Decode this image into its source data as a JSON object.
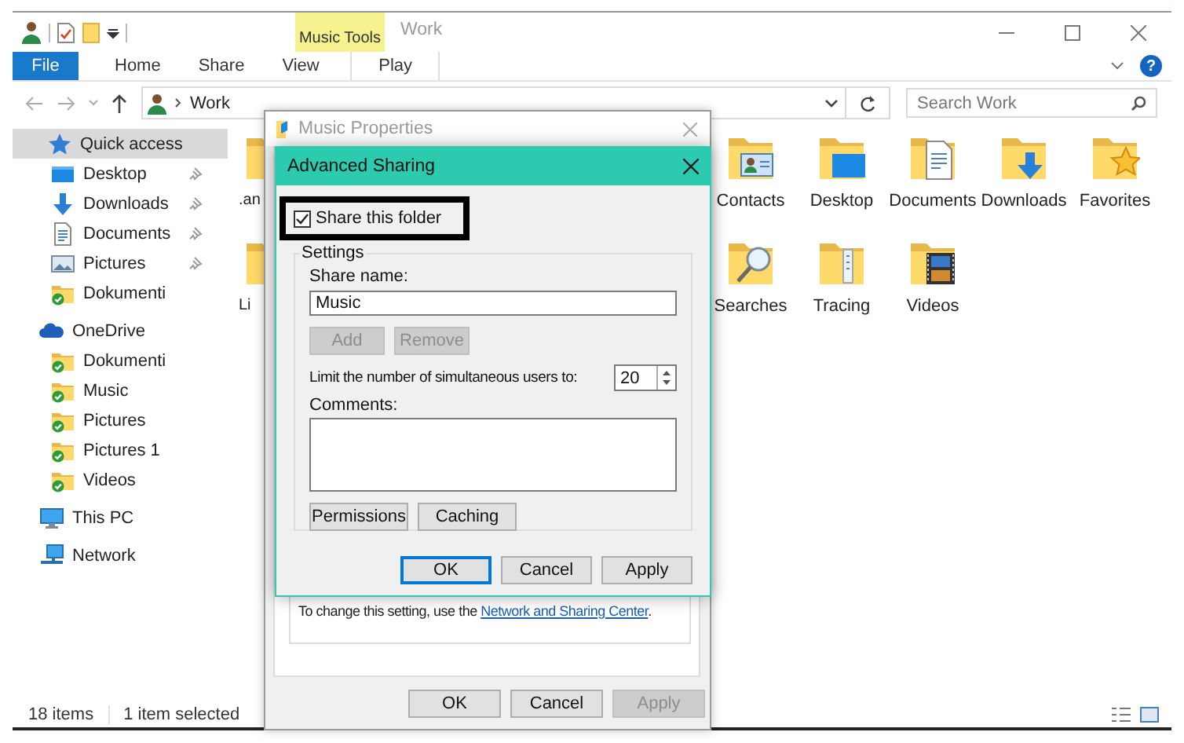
{
  "title_bar": {
    "contextual_group": "Music Tools",
    "title": "Work"
  },
  "ribbon": {
    "tabs": [
      {
        "label": "File",
        "kind": "file",
        "selected": false
      },
      {
        "label": "Home",
        "kind": "tab",
        "selected": false
      },
      {
        "label": "Share",
        "kind": "tab",
        "selected": false
      },
      {
        "label": "View",
        "kind": "tab",
        "selected": false
      },
      {
        "label": "Play",
        "kind": "contextual",
        "selected": false
      }
    ],
    "help": "?"
  },
  "address_bar": {
    "path": "Work"
  },
  "search": {
    "placeholder": "Search Work"
  },
  "sidebar": {
    "items": [
      {
        "label": "Quick access",
        "kind": "star",
        "selected": true,
        "children": [
          {
            "label": "Desktop",
            "kind": "desktop",
            "pinned": true,
            "selected": false
          },
          {
            "label": "Downloads",
            "kind": "downloads",
            "pinned": true,
            "selected": false
          },
          {
            "label": "Documents",
            "kind": "documents",
            "pinned": true,
            "selected": false
          },
          {
            "label": "Pictures",
            "kind": "pictures",
            "pinned": true,
            "selected": false
          },
          {
            "label": "Dokumenti",
            "kind": "synced",
            "pinned": false,
            "selected": false
          }
        ]
      },
      {
        "label": "OneDrive",
        "kind": "cloud",
        "selected": false,
        "children": [
          {
            "label": "Dokumenti",
            "kind": "synced",
            "pinned": false,
            "selected": false
          },
          {
            "label": "Music",
            "kind": "synced",
            "pinned": false,
            "selected": false
          },
          {
            "label": "Pictures",
            "kind": "synced",
            "pinned": false,
            "selected": false
          },
          {
            "label": "Pictures 1",
            "kind": "synced",
            "pinned": false,
            "selected": false
          },
          {
            "label": "Videos",
            "kind": "synced",
            "pinned": false,
            "selected": false
          }
        ]
      },
      {
        "label": "This PC",
        "kind": "pc",
        "selected": false
      },
      {
        "label": "Network",
        "kind": "network",
        "selected": false
      }
    ]
  },
  "content": {
    "items": [
      {
        "label": ".an",
        "kind": "folder"
      },
      {
        "label": "Contacts",
        "kind": "contacts"
      },
      {
        "label": "Desktop",
        "kind": "desktop"
      },
      {
        "label": "Documents",
        "kind": "documents"
      },
      {
        "label": "Downloads",
        "kind": "downloads"
      },
      {
        "label": "Favorites",
        "kind": "favorites"
      },
      {
        "label": "Li",
        "kind": "folder"
      },
      {
        "label": "Searches",
        "kind": "searches"
      },
      {
        "label": "Tracing",
        "kind": "tracing"
      },
      {
        "label": "Videos",
        "kind": "videos"
      }
    ]
  },
  "status_bar": {
    "item_count": "18 items",
    "selection": "1 item selected"
  },
  "music_properties": {
    "title": "Music Properties",
    "note": "To change this setting, use the",
    "link": "Network and Sharing Center",
    "note_end": ".",
    "buttons": [
      {
        "label": "OK",
        "disabled": false
      },
      {
        "label": "Cancel",
        "disabled": false
      },
      {
        "label": "Apply",
        "disabled": true
      }
    ]
  },
  "advanced_sharing": {
    "title": "Advanced Sharing",
    "share_folder": {
      "label": "Share this folder",
      "checked": true,
      "highlighted": true
    },
    "settings_label": "Settings",
    "share_name_label": "Share name:",
    "share_name": "Music",
    "name_buttons": [
      {
        "label": "Add",
        "disabled": true
      },
      {
        "label": "Remove",
        "disabled": true
      }
    ],
    "user_limit_label": "Limit the number of simultaneous users to:",
    "user_limit": "20",
    "comments_label": "Comments:",
    "option_buttons": [
      {
        "label": "Permissions",
        "disabled": false
      },
      {
        "label": "Caching",
        "disabled": false
      }
    ],
    "buttons": [
      {
        "label": "OK",
        "disabled": false,
        "default": true
      },
      {
        "label": "Cancel",
        "disabled": false,
        "default": false
      },
      {
        "label": "Apply",
        "disabled": false,
        "default": false
      }
    ]
  }
}
